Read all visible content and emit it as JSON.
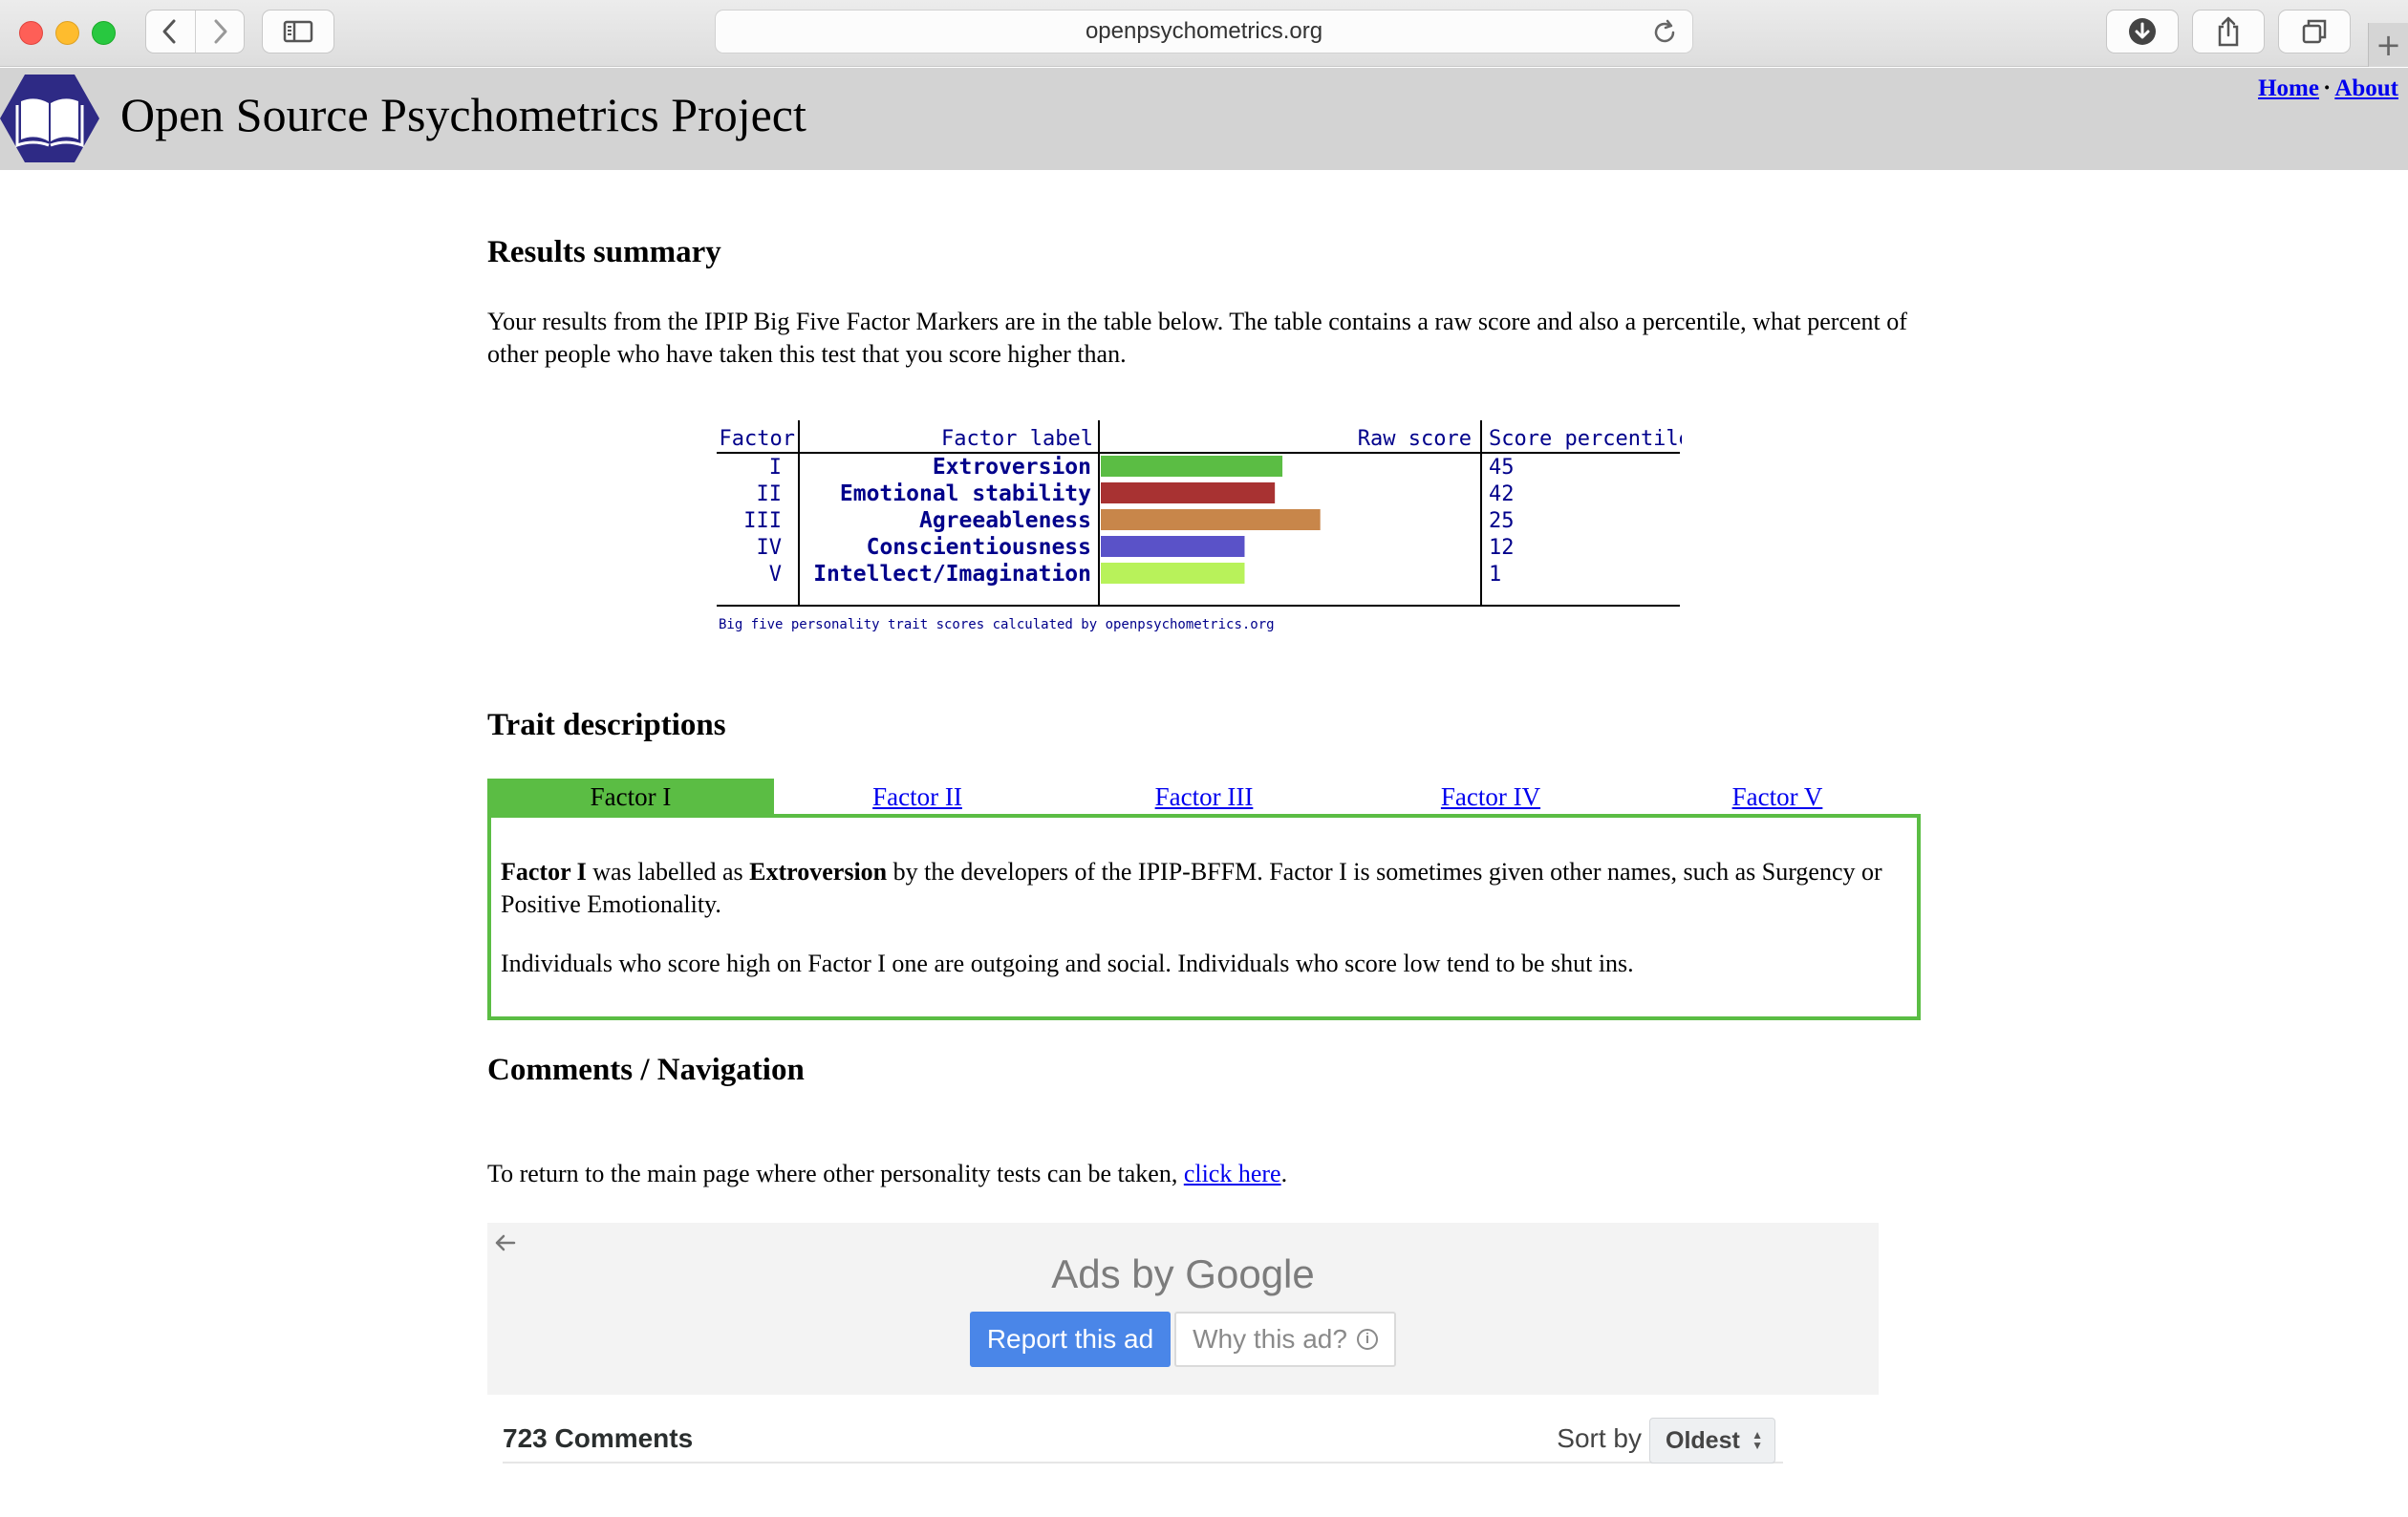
{
  "browser": {
    "url": "openpsychometrics.org",
    "icons": [
      "back-icon",
      "forward-icon",
      "sidebar-icon",
      "reload-icon",
      "download-icon",
      "share-icon",
      "tabs-overview-icon",
      "new-tab-icon"
    ],
    "new_tab_label": "+"
  },
  "site": {
    "title": "Open Source Psychometrics Project",
    "nav": {
      "home": "Home",
      "separator": "·",
      "about": "About"
    }
  },
  "results": {
    "heading": "Results summary",
    "intro": "Your results from the IPIP Big Five Factor Markers are in the table below. The table contains a raw score and also a percentile, what percent of other people who have taken this test that you score higher than."
  },
  "chart_data": {
    "type": "bar",
    "columns": [
      "Factor",
      "Factor label",
      "Raw score",
      "Score percentile"
    ],
    "rows": [
      {
        "factor": "I",
        "label": "Extroversion",
        "percentile": 45,
        "color": "#5bbd44"
      },
      {
        "factor": "II",
        "label": "Emotional stability",
        "percentile": 42,
        "color": "#a83232"
      },
      {
        "factor": "III",
        "label": "Agreeableness",
        "percentile": 25,
        "color": "#c8864a"
      },
      {
        "factor": "IV",
        "label": "Conscientiousness",
        "percentile": 12,
        "color": "#5a52c8"
      },
      {
        "factor": "V",
        "label": "Intellect/Imagination",
        "percentile": 1,
        "color": "#b8f25a"
      }
    ],
    "raw_scores_bar_extent": [
      0.48,
      0.46,
      0.58,
      0.38,
      0.38
    ],
    "caption": "Big five personality trait scores calculated by openpsychometrics.org"
  },
  "traits": {
    "heading": "Trait descriptions",
    "tabs": [
      {
        "label": "Factor I",
        "active": true
      },
      {
        "label": "Factor II",
        "active": false
      },
      {
        "label": "Factor III",
        "active": false
      },
      {
        "label": "Factor IV",
        "active": false
      },
      {
        "label": "Factor V",
        "active": false
      }
    ],
    "panel": {
      "p1_factor": "Factor I",
      "p1_mid": " was labelled as ",
      "p1_trait": "Extroversion",
      "p1_rest": " by the developers of the IPIP-BFFM. Factor I is sometimes given other names, such as Surgency or Positive Emotionality.",
      "p2": "Individuals who score high on Factor I one are outgoing and social. Individuals who score low tend to be shut ins."
    }
  },
  "comments_nav": {
    "heading": "Comments / Navigation",
    "return_text": "To return to the main page where other personality tests can be taken, ",
    "return_link": "click here",
    "return_end": "."
  },
  "ad": {
    "ads_by": "Ads by Google",
    "report": "Report this ad",
    "why": "Why this ad?",
    "info_glyph": "i"
  },
  "comments": {
    "count_label": "723 Comments",
    "sort_label": "Sort by",
    "sort_value": "Oldest"
  }
}
